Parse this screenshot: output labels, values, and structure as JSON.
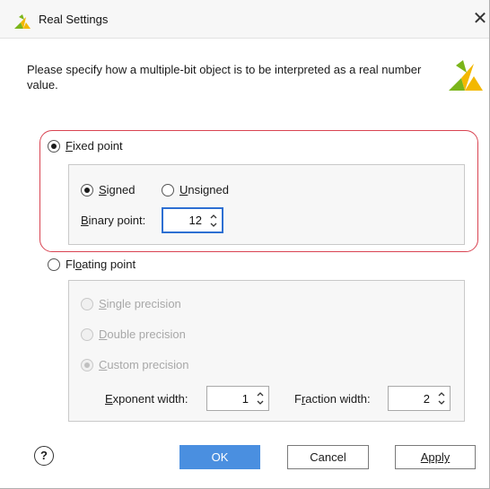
{
  "window": {
    "title": "Real Settings",
    "close_glyph": "✕"
  },
  "description": "Please specify how a multiple-bit object is to be interpreted as a real number value.",
  "fixed_point": {
    "label_prefix": "F",
    "label_rest": "ixed point",
    "checked": true,
    "signed": {
      "prefix": "S",
      "rest": "igned",
      "checked": true
    },
    "unsigned": {
      "prefix": "U",
      "rest": "nsigned",
      "checked": false
    },
    "binary_point": {
      "prefix": "B",
      "rest": "inary point:",
      "value": "12"
    }
  },
  "floating_point": {
    "label_prefix": "Fl",
    "label_u": "o",
    "label_rest": "ating point",
    "checked": false,
    "single": {
      "prefix": "S",
      "rest": "ingle precision"
    },
    "double": {
      "prefix": "D",
      "rest": "ouble precision"
    },
    "custom": {
      "prefix": "C",
      "rest": "ustom precision",
      "checked": true
    },
    "exponent_width": {
      "prefix": "E",
      "rest": "xponent width:",
      "value": "1"
    },
    "fraction_width": {
      "pre": "F",
      "u": "r",
      "rest": "action width:",
      "value": "2"
    }
  },
  "buttons": {
    "help": "?",
    "ok": "OK",
    "cancel": "Cancel",
    "apply": "Apply"
  },
  "colors": {
    "accent": "#4a8fe0",
    "highlight": "#d94452",
    "logo_green": "#7bb51a",
    "logo_yellow": "#f3b800"
  },
  "icons": {
    "logo": "vivado-logo-icon",
    "spin": "spin-arrows-icon",
    "help": "help-icon"
  }
}
